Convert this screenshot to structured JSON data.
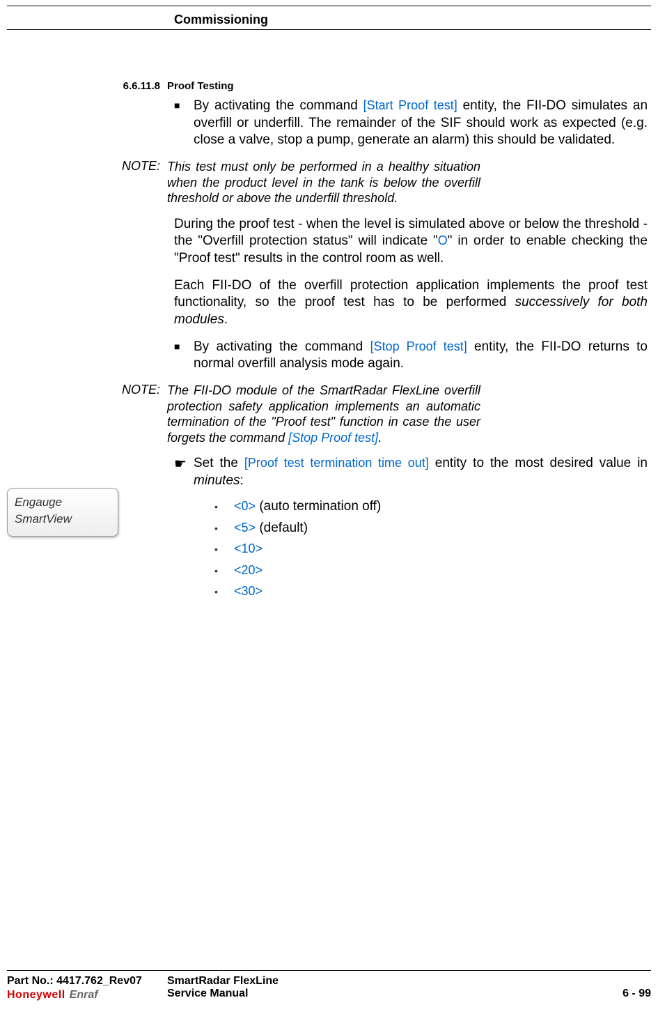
{
  "header": {
    "title": "Commissioning"
  },
  "section": {
    "number": "6.6.11.8",
    "title": "Proof Testing"
  },
  "bullet1": {
    "pre": "By activating the command ",
    "entity": "[Start Proof test]",
    "post": " entity, the FII-DO simulates an overfill or underfill. The remainder of the SIF should work as expected (e.g. close a valve, stop a pump, generate an alarm) this should be validated."
  },
  "note1": {
    "label": "NOTE:",
    "text": "This test must only be performed in a healthy situation when the product level in the tank is below the overfill threshold or above the underfill threshold."
  },
  "para1": {
    "pre": "During the proof test - when the level is simulated above or below the threshold - the \"Overfill protection status\" will indicate \"",
    "code": "O",
    "post": "\" in order to enable checking the \"Proof test\" results in the control room as well."
  },
  "para2": {
    "a": "Each FII-DO of the overfill protection application implements the proof test functionality, so the proof test has to be performed ",
    "b": "successively for both modules",
    "c": "."
  },
  "bullet2": {
    "pre": "By activating the command ",
    "entity": "[Stop Proof test]",
    "post": " entity, the FII-DO returns to normal overfill analysis mode again."
  },
  "note2": {
    "label": "NOTE:",
    "pre": "The FII-DO module of the SmartRadar FlexLine overfill protection safety application implements an automatic termination of the \"Proof test\" function in case the user forgets the command ",
    "entity": "[Stop Proof test]",
    "post": "."
  },
  "pointer": {
    "pre": "Set the ",
    "entity": "[Proof test termination time out]",
    "mid": " entity to the most desired value in ",
    "em": "minutes",
    "post": ":"
  },
  "options": [
    {
      "code": "<0>",
      "text": " (auto termination off)"
    },
    {
      "code": "<5>",
      "text": " (default)"
    },
    {
      "code": "<10>",
      "text": ""
    },
    {
      "code": "<20>",
      "text": ""
    },
    {
      "code": "<30>",
      "text": ""
    }
  ],
  "callout": {
    "line1": "Engauge",
    "line2": "SmartView"
  },
  "footer": {
    "part": "Part No.: 4417.762_Rev07",
    "product": "SmartRadar FlexLine",
    "doc": "Service Manual",
    "page": "6 - 99",
    "brand1": "Honeywell",
    "brand2": "Enraf"
  }
}
